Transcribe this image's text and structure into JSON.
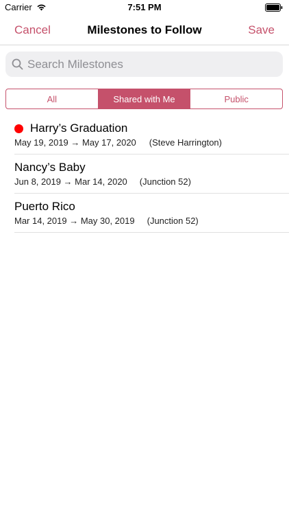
{
  "status_bar": {
    "carrier": "Carrier",
    "time": "7:51 PM",
    "icons": [
      "wifi-icon",
      "battery-icon"
    ]
  },
  "nav": {
    "cancel_label": "Cancel",
    "title": "Milestones to Follow",
    "save_label": "Save",
    "accent_color": "#c5516b"
  },
  "search": {
    "placeholder": "Search Milestones",
    "value": "",
    "icon": "search-icon"
  },
  "segments": {
    "items": [
      "All",
      "Shared with Me",
      "Public"
    ],
    "selected": "Shared with Me"
  },
  "milestones": [
    {
      "title": "Harry’s Graduation",
      "dates": "May 19, 2019 → May 17, 2020",
      "owner": "(Steve Harrington)",
      "indicator": "red-dot",
      "indicator_color": "#ff0000"
    },
    {
      "title": "Nancy’s Baby",
      "dates": "Jun 8, 2019 → Mar 14, 2020",
      "owner": "(Junction 52)"
    },
    {
      "title": "Puerto Rico",
      "dates": "Mar 14, 2019 → May 30, 2019",
      "owner": "(Junction 52)"
    }
  ]
}
